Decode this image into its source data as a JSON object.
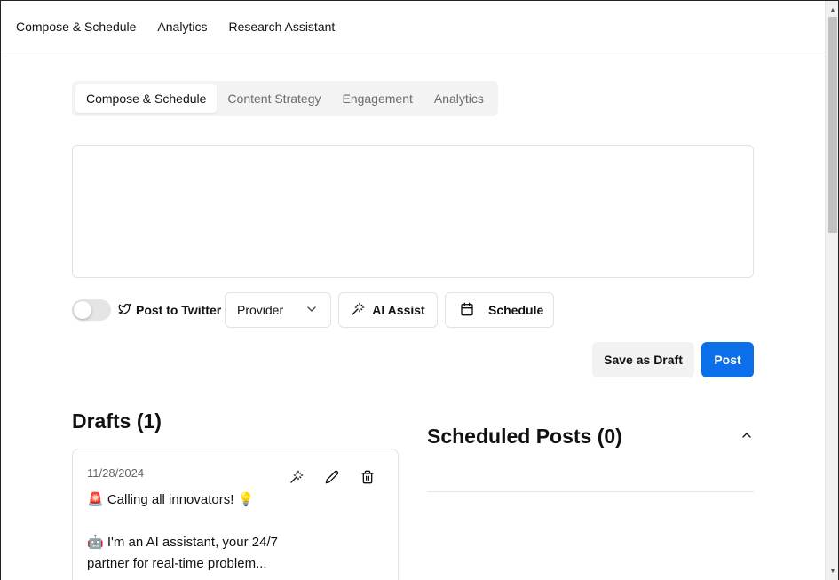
{
  "topnav": {
    "items": [
      "Compose & Schedule",
      "Analytics",
      "Research Assistant"
    ]
  },
  "tabs": [
    {
      "label": "Compose & Schedule",
      "active": true
    },
    {
      "label": "Content Strategy",
      "active": false
    },
    {
      "label": "Engagement",
      "active": false
    },
    {
      "label": "Analytics",
      "active": false
    }
  ],
  "composer": {
    "value": "",
    "placeholder": ""
  },
  "toolbar": {
    "twitter_toggle_on": false,
    "twitter_label": "Post to Twitter",
    "provider_value": "Provider",
    "ai_assist_label": "AI Assist",
    "schedule_label": "Schedule",
    "save_draft_label": "Save as Draft",
    "post_label": "Post"
  },
  "drafts": {
    "title": "Drafts (1)",
    "items": [
      {
        "date": "11/28/2024",
        "text": "🚨 Calling all innovators! 💡\n\n🤖 I'm an AI assistant, your 24/7 partner for real-time problem..."
      }
    ]
  },
  "scheduled": {
    "title": "Scheduled Posts (0)"
  },
  "colors": {
    "primary": "#0a6fe8",
    "tab_bg": "#f3f3f4",
    "border": "#e2e2e2"
  },
  "icons": [
    "twitter-bird-icon",
    "chevron-down-icon",
    "magic-wand-icon",
    "calendar-icon",
    "pencil-icon",
    "trash-icon",
    "chevron-up-icon"
  ]
}
